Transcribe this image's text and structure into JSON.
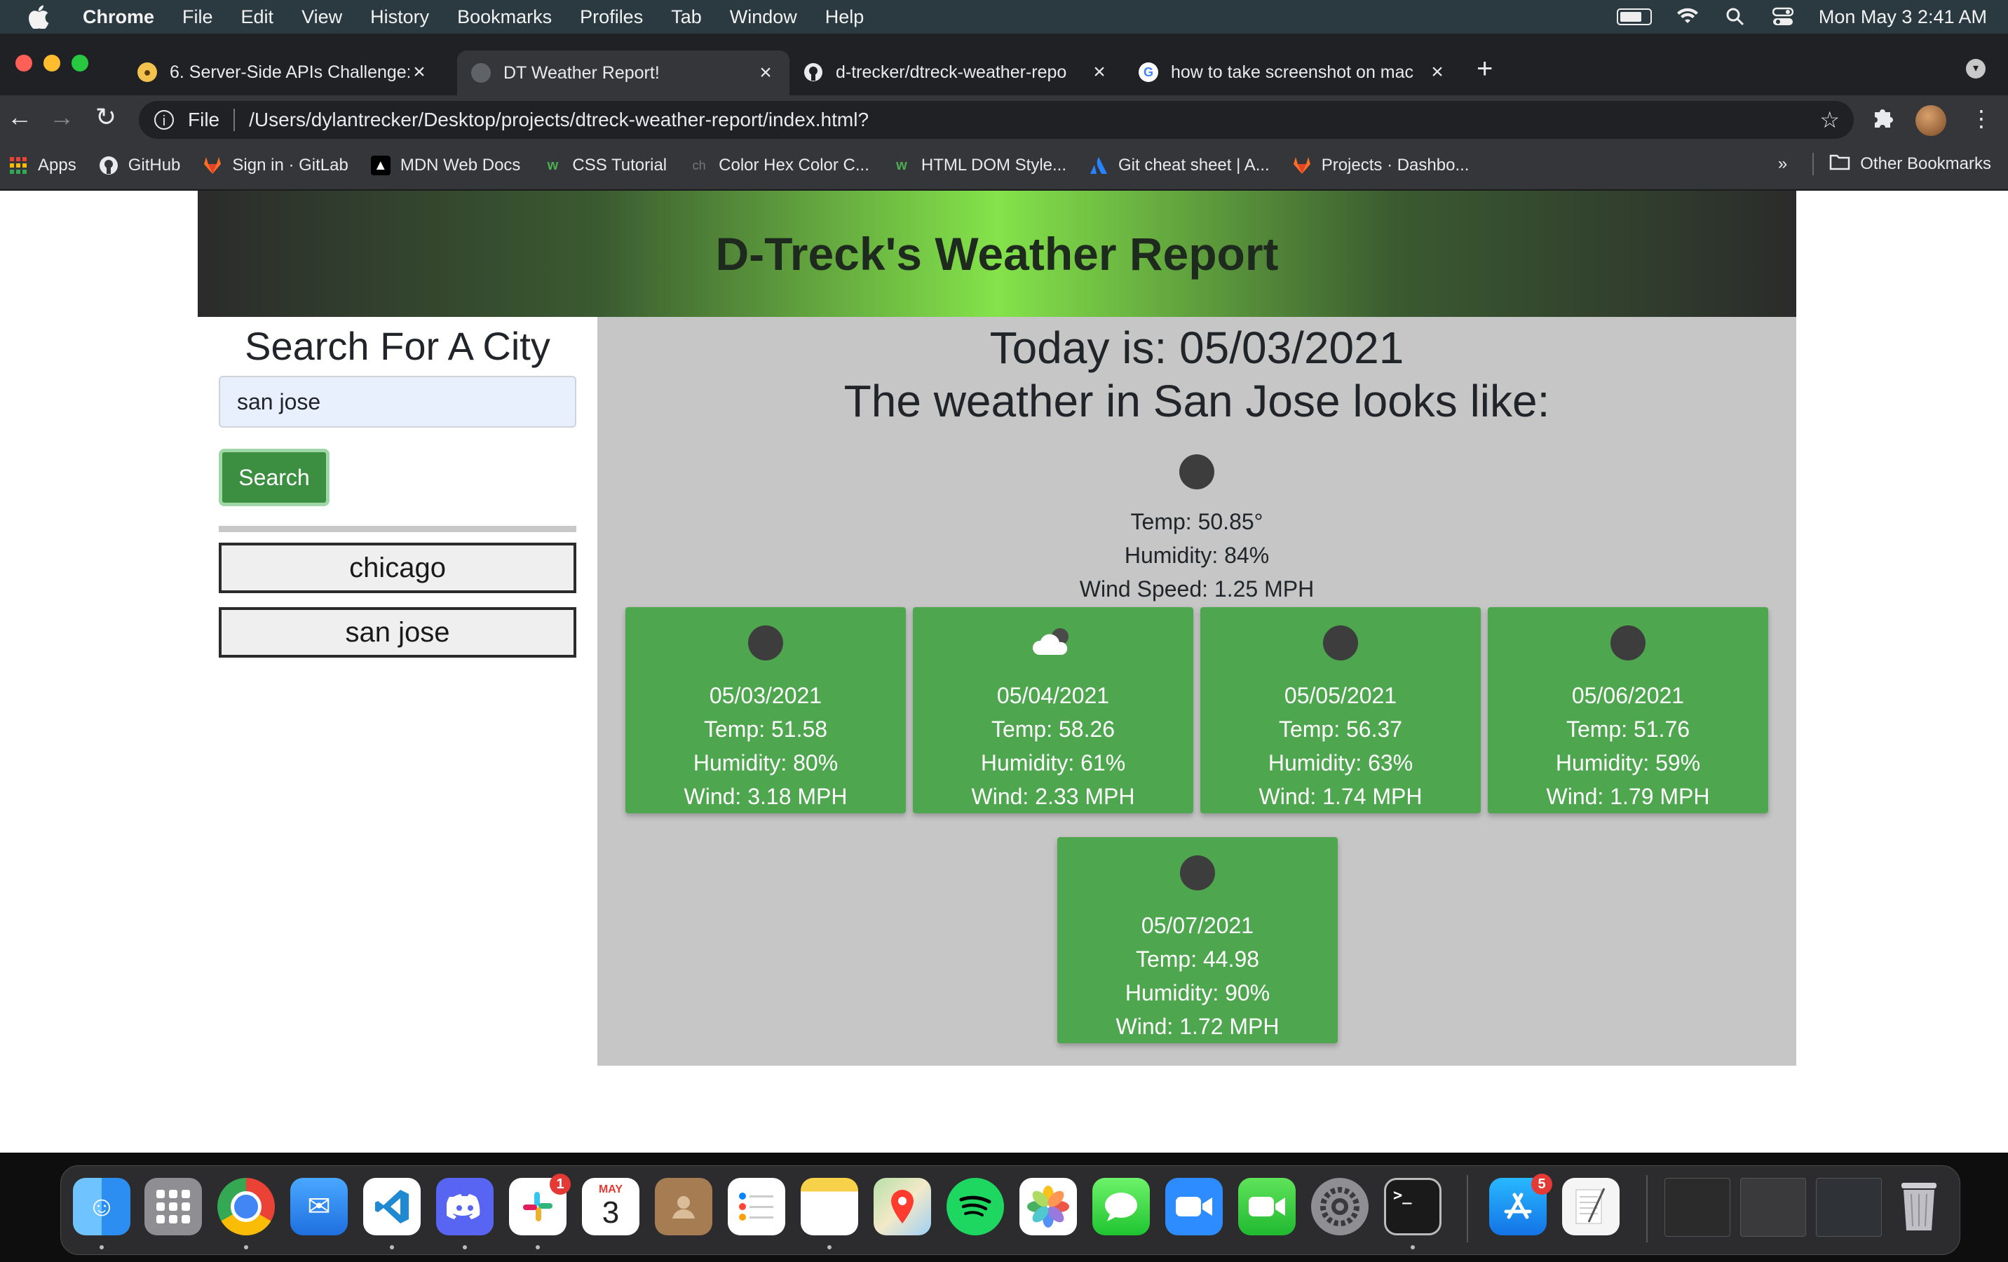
{
  "menubar": {
    "app": "Chrome",
    "items": [
      "File",
      "Edit",
      "View",
      "History",
      "Bookmarks",
      "Profiles",
      "Tab",
      "Window",
      "Help"
    ],
    "datetime": "Mon May 3  2:41 AM"
  },
  "tabs": [
    {
      "label": "6. Server-Side APIs Challenge:"
    },
    {
      "label": "DT Weather Report!"
    },
    {
      "label": "d-trecker/dtreck-weather-repo"
    },
    {
      "label": "how to take screenshot on mac"
    }
  ],
  "address": {
    "scheme_label": "File",
    "url": "/Users/dylantrecker/Desktop/projects/dtreck-weather-report/index.html?"
  },
  "bookmarks": {
    "items": [
      "Apps",
      "GitHub",
      "Sign in · GitLab",
      "MDN Web Docs",
      "CSS Tutorial",
      "Color Hex Color C...",
      "HTML DOM Style...",
      "Git cheat sheet | A...",
      "Projects · Dashbo..."
    ],
    "overflow": "»",
    "other": "Other Bookmarks"
  },
  "page": {
    "title": "D-Treck's Weather Report",
    "sidebar": {
      "heading": "Search For A City",
      "search_value": "san jose",
      "search_button": "Search",
      "history": [
        "chicago",
        "san jose"
      ]
    },
    "today": "Today is: 05/03/2021",
    "weather_title": "The weather in San Jose looks like:",
    "current": {
      "temp": "Temp: 50.85°",
      "humidity": "Humidity: 84%",
      "wind": "Wind Speed: 1.25 MPH"
    },
    "forecast": [
      {
        "date": "05/03/2021",
        "temp": "Temp: 51.58",
        "humidity": "Humidity: 80%",
        "wind": "Wind: 3.18 MPH",
        "icon": "dark-circle-icon"
      },
      {
        "date": "05/04/2021",
        "temp": "Temp: 58.26",
        "humidity": "Humidity: 61%",
        "wind": "Wind: 2.33 MPH",
        "icon": "cloud-icon"
      },
      {
        "date": "05/05/2021",
        "temp": "Temp: 56.37",
        "humidity": "Humidity: 63%",
        "wind": "Wind: 1.74 MPH",
        "icon": "dark-circle-icon"
      },
      {
        "date": "05/06/2021",
        "temp": "Temp: 51.76",
        "humidity": "Humidity: 59%",
        "wind": "Wind: 1.79 MPH",
        "icon": "dark-circle-icon"
      },
      {
        "date": "05/07/2021",
        "temp": "Temp: 44.98",
        "humidity": "Humidity: 90%",
        "wind": "Wind: 1.72 MPH",
        "icon": "dark-circle-icon"
      }
    ]
  },
  "dock": {
    "calendar_month": "MAY",
    "calendar_day": "3",
    "badges": {
      "slack": "1",
      "app_store": "5"
    }
  },
  "colors": {
    "card_green": "#4ea64e",
    "button_green": "#3c8f40",
    "main_panel": "#c6c6c6"
  }
}
